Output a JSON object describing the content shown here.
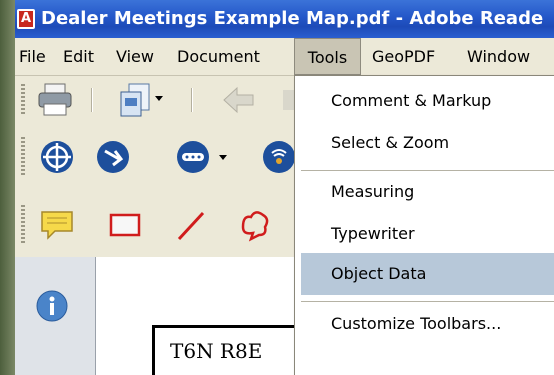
{
  "window": {
    "title": "Dealer Meetings Example Map.pdf - Adobe Reade"
  },
  "menubar": {
    "items": [
      "File",
      "Edit",
      "View",
      "Document",
      "Tools",
      "GeoPDF",
      "Window"
    ]
  },
  "tools_menu": {
    "items": [
      {
        "label": "Comment & Markup"
      },
      {
        "label": "Select & Zoom"
      },
      {
        "label": "Measuring"
      },
      {
        "label": "Typewriter"
      },
      {
        "label": "Object Data"
      },
      {
        "label": "Customize Toolbars..."
      }
    ]
  },
  "document": {
    "visible_text": "T6N R8E"
  },
  "colors": {
    "titlebar": "#2457c9",
    "chrome": "#ece9d8",
    "highlight": "#b7c8d9"
  }
}
